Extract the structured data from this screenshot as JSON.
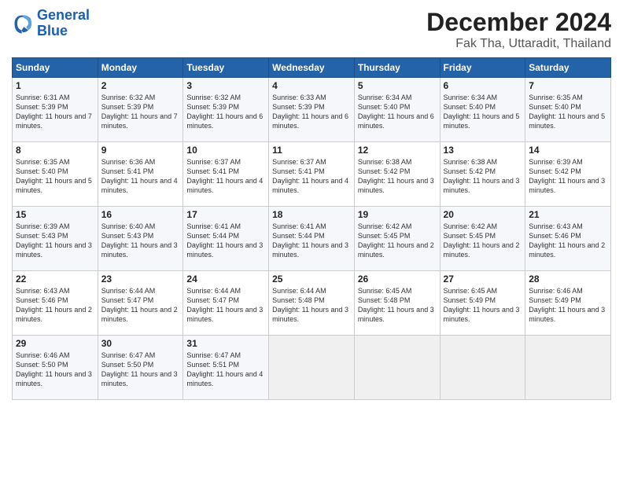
{
  "logo": {
    "line1": "General",
    "line2": "Blue"
  },
  "title": "December 2024",
  "location": "Fak Tha, Uttaradit, Thailand",
  "header_days": [
    "Sunday",
    "Monday",
    "Tuesday",
    "Wednesday",
    "Thursday",
    "Friday",
    "Saturday"
  ],
  "weeks": [
    [
      {
        "day": "1",
        "rise": "Sunrise: 6:31 AM",
        "set": "Sunset: 5:39 PM",
        "daylight": "Daylight: 11 hours and 7 minutes."
      },
      {
        "day": "2",
        "rise": "Sunrise: 6:32 AM",
        "set": "Sunset: 5:39 PM",
        "daylight": "Daylight: 11 hours and 7 minutes."
      },
      {
        "day": "3",
        "rise": "Sunrise: 6:32 AM",
        "set": "Sunset: 5:39 PM",
        "daylight": "Daylight: 11 hours and 6 minutes."
      },
      {
        "day": "4",
        "rise": "Sunrise: 6:33 AM",
        "set": "Sunset: 5:39 PM",
        "daylight": "Daylight: 11 hours and 6 minutes."
      },
      {
        "day": "5",
        "rise": "Sunrise: 6:34 AM",
        "set": "Sunset: 5:40 PM",
        "daylight": "Daylight: 11 hours and 6 minutes."
      },
      {
        "day": "6",
        "rise": "Sunrise: 6:34 AM",
        "set": "Sunset: 5:40 PM",
        "daylight": "Daylight: 11 hours and 5 minutes."
      },
      {
        "day": "7",
        "rise": "Sunrise: 6:35 AM",
        "set": "Sunset: 5:40 PM",
        "daylight": "Daylight: 11 hours and 5 minutes."
      }
    ],
    [
      {
        "day": "8",
        "rise": "Sunrise: 6:35 AM",
        "set": "Sunset: 5:40 PM",
        "daylight": "Daylight: 11 hours and 5 minutes."
      },
      {
        "day": "9",
        "rise": "Sunrise: 6:36 AM",
        "set": "Sunset: 5:41 PM",
        "daylight": "Daylight: 11 hours and 4 minutes."
      },
      {
        "day": "10",
        "rise": "Sunrise: 6:37 AM",
        "set": "Sunset: 5:41 PM",
        "daylight": "Daylight: 11 hours and 4 minutes."
      },
      {
        "day": "11",
        "rise": "Sunrise: 6:37 AM",
        "set": "Sunset: 5:41 PM",
        "daylight": "Daylight: 11 hours and 4 minutes."
      },
      {
        "day": "12",
        "rise": "Sunrise: 6:38 AM",
        "set": "Sunset: 5:42 PM",
        "daylight": "Daylight: 11 hours and 3 minutes."
      },
      {
        "day": "13",
        "rise": "Sunrise: 6:38 AM",
        "set": "Sunset: 5:42 PM",
        "daylight": "Daylight: 11 hours and 3 minutes."
      },
      {
        "day": "14",
        "rise": "Sunrise: 6:39 AM",
        "set": "Sunset: 5:42 PM",
        "daylight": "Daylight: 11 hours and 3 minutes."
      }
    ],
    [
      {
        "day": "15",
        "rise": "Sunrise: 6:39 AM",
        "set": "Sunset: 5:43 PM",
        "daylight": "Daylight: 11 hours and 3 minutes."
      },
      {
        "day": "16",
        "rise": "Sunrise: 6:40 AM",
        "set": "Sunset: 5:43 PM",
        "daylight": "Daylight: 11 hours and 3 minutes."
      },
      {
        "day": "17",
        "rise": "Sunrise: 6:41 AM",
        "set": "Sunset: 5:44 PM",
        "daylight": "Daylight: 11 hours and 3 minutes."
      },
      {
        "day": "18",
        "rise": "Sunrise: 6:41 AM",
        "set": "Sunset: 5:44 PM",
        "daylight": "Daylight: 11 hours and 3 minutes."
      },
      {
        "day": "19",
        "rise": "Sunrise: 6:42 AM",
        "set": "Sunset: 5:45 PM",
        "daylight": "Daylight: 11 hours and 2 minutes."
      },
      {
        "day": "20",
        "rise": "Sunrise: 6:42 AM",
        "set": "Sunset: 5:45 PM",
        "daylight": "Daylight: 11 hours and 2 minutes."
      },
      {
        "day": "21",
        "rise": "Sunrise: 6:43 AM",
        "set": "Sunset: 5:46 PM",
        "daylight": "Daylight: 11 hours and 2 minutes."
      }
    ],
    [
      {
        "day": "22",
        "rise": "Sunrise: 6:43 AM",
        "set": "Sunset: 5:46 PM",
        "daylight": "Daylight: 11 hours and 2 minutes."
      },
      {
        "day": "23",
        "rise": "Sunrise: 6:44 AM",
        "set": "Sunset: 5:47 PM",
        "daylight": "Daylight: 11 hours and 2 minutes."
      },
      {
        "day": "24",
        "rise": "Sunrise: 6:44 AM",
        "set": "Sunset: 5:47 PM",
        "daylight": "Daylight: 11 hours and 3 minutes."
      },
      {
        "day": "25",
        "rise": "Sunrise: 6:44 AM",
        "set": "Sunset: 5:48 PM",
        "daylight": "Daylight: 11 hours and 3 minutes."
      },
      {
        "day": "26",
        "rise": "Sunrise: 6:45 AM",
        "set": "Sunset: 5:48 PM",
        "daylight": "Daylight: 11 hours and 3 minutes."
      },
      {
        "day": "27",
        "rise": "Sunrise: 6:45 AM",
        "set": "Sunset: 5:49 PM",
        "daylight": "Daylight: 11 hours and 3 minutes."
      },
      {
        "day": "28",
        "rise": "Sunrise: 6:46 AM",
        "set": "Sunset: 5:49 PM",
        "daylight": "Daylight: 11 hours and 3 minutes."
      }
    ],
    [
      {
        "day": "29",
        "rise": "Sunrise: 6:46 AM",
        "set": "Sunset: 5:50 PM",
        "daylight": "Daylight: 11 hours and 3 minutes."
      },
      {
        "day": "30",
        "rise": "Sunrise: 6:47 AM",
        "set": "Sunset: 5:50 PM",
        "daylight": "Daylight: 11 hours and 3 minutes."
      },
      {
        "day": "31",
        "rise": "Sunrise: 6:47 AM",
        "set": "Sunset: 5:51 PM",
        "daylight": "Daylight: 11 hours and 4 minutes."
      },
      null,
      null,
      null,
      null
    ]
  ]
}
